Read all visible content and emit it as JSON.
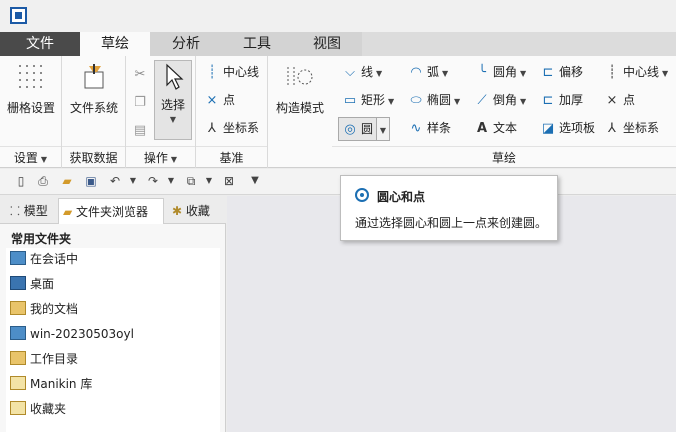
{
  "ribbon_tabs": [
    "文件",
    "草绘",
    "分析",
    "工具",
    "视图"
  ],
  "groups": {
    "settings": {
      "label": "设置",
      "grid": "栅格设置"
    },
    "getdata": {
      "label": "获取数据",
      "filesystem": "文件系统"
    },
    "operations": {
      "label": "操作",
      "select": "选择"
    },
    "datum": {
      "label": "基准",
      "centerline": "中心线",
      "point": "点",
      "csys": "坐标系"
    },
    "construct": {
      "label": "构造模式"
    },
    "sketch": {
      "label": "草绘",
      "line": "线",
      "arc": "弧",
      "fillet": "圆角",
      "offset": "偏移",
      "centerline2": "中心线",
      "rectangle": "矩形",
      "ellipse": "椭圆",
      "chamfer": "倒角",
      "thicken": "加厚",
      "point2": "点",
      "circle": "圆",
      "spline": "样条",
      "text": "文本",
      "palette": "选项板",
      "csys2": "坐标系"
    }
  },
  "panel": {
    "tabs": [
      "模型",
      "文件夹浏览器",
      "收藏"
    ],
    "section": "常用文件夹",
    "items": [
      "在会话中",
      "桌面",
      "我的文档",
      "win-20230503oyl",
      "工作目录",
      "Manikin 库",
      "收藏夹"
    ]
  },
  "tooltip": {
    "title": "圆心和点",
    "desc": "通过选择圆心和圆上一点来创建圆。"
  }
}
